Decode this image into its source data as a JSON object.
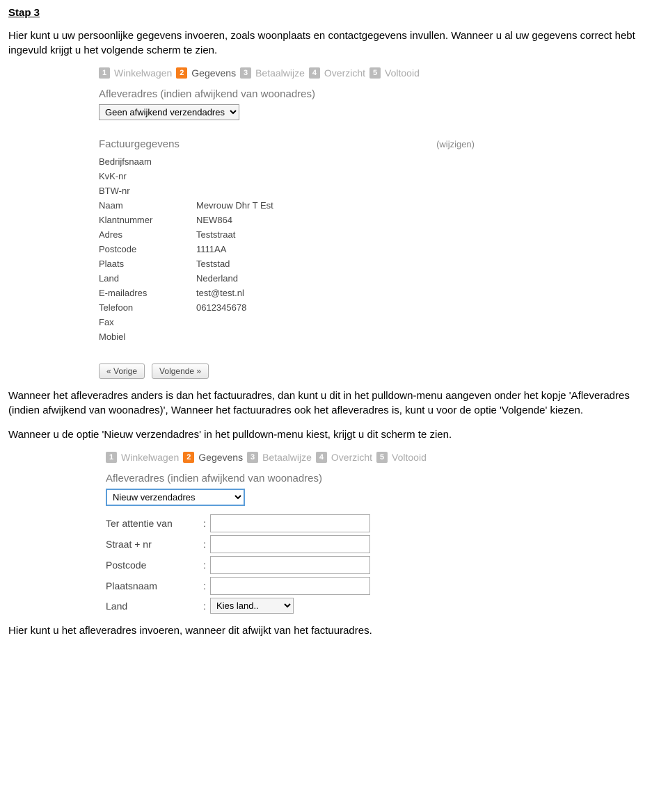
{
  "heading": "Stap 3",
  "intro": "Hier kunt u uw persoonlijke gegevens invoeren, zoals woonplaats en contactgegevens invullen. Wanneer u al uw gegevens correct hebt ingevuld krijgt u het volgende scherm te zien.",
  "steps": [
    {
      "num": "1",
      "label": "Winkelwagen"
    },
    {
      "num": "2",
      "label": "Gegevens"
    },
    {
      "num": "3",
      "label": "Betaalwijze"
    },
    {
      "num": "4",
      "label": "Overzicht"
    },
    {
      "num": "5",
      "label": "Voltooid"
    }
  ],
  "shot1": {
    "afleveradresTitle": "Afleveradres (indien afwijkend van woonadres)",
    "afleveradresSelected": "Geen afwijkend verzendadres",
    "factuurTitle": "Factuurgegevens",
    "wijzigen": "(wijzigen)",
    "rows": [
      {
        "label": "Bedrijfsnaam",
        "value": ""
      },
      {
        "label": "KvK-nr",
        "value": ""
      },
      {
        "label": "BTW-nr",
        "value": ""
      },
      {
        "label": "Naam",
        "value": "Mevrouw Dhr T Est"
      },
      {
        "label": "Klantnummer",
        "value": "NEW864"
      },
      {
        "label": "Adres",
        "value": "Teststraat"
      },
      {
        "label": "Postcode",
        "value": "1111AA"
      },
      {
        "label": "Plaats",
        "value": "Teststad"
      },
      {
        "label": "Land",
        "value": "Nederland"
      },
      {
        "label": "E-mailadres",
        "value": "test@test.nl"
      },
      {
        "label": "Telefoon",
        "value": "0612345678"
      },
      {
        "label": "Fax",
        "value": ""
      },
      {
        "label": "Mobiel",
        "value": ""
      }
    ],
    "prev": "« Vorige",
    "next": "Volgende »"
  },
  "mid": "Wanneer het afleveradres anders is dan het factuuradres, dan kunt u dit in het pulldown-menu aangeven onder het kopje 'Afleveradres (indien afwijkend van woonadres)', Wanneer het factuuradres ook het afleveradres is, kunt u voor de optie 'Volgende' kiezen.",
  "mid2": "Wanneer u de optie 'Nieuw verzendadres' in het pulldown-menu kiest, krijgt u dit scherm te zien.",
  "shot2": {
    "afleveradresTitle": "Afleveradres (indien afwijkend van woonadres)",
    "afleveradresSelected": "Nieuw verzendadres",
    "fields": [
      {
        "label": "Ter attentie van"
      },
      {
        "label": "Straat + nr"
      },
      {
        "label": "Postcode"
      },
      {
        "label": "Plaatsnaam"
      }
    ],
    "landLabel": "Land",
    "landValue": "Kies land.."
  },
  "outro": "Hier kunt u het afleveradres invoeren, wanneer dit afwijkt van het factuuradres."
}
